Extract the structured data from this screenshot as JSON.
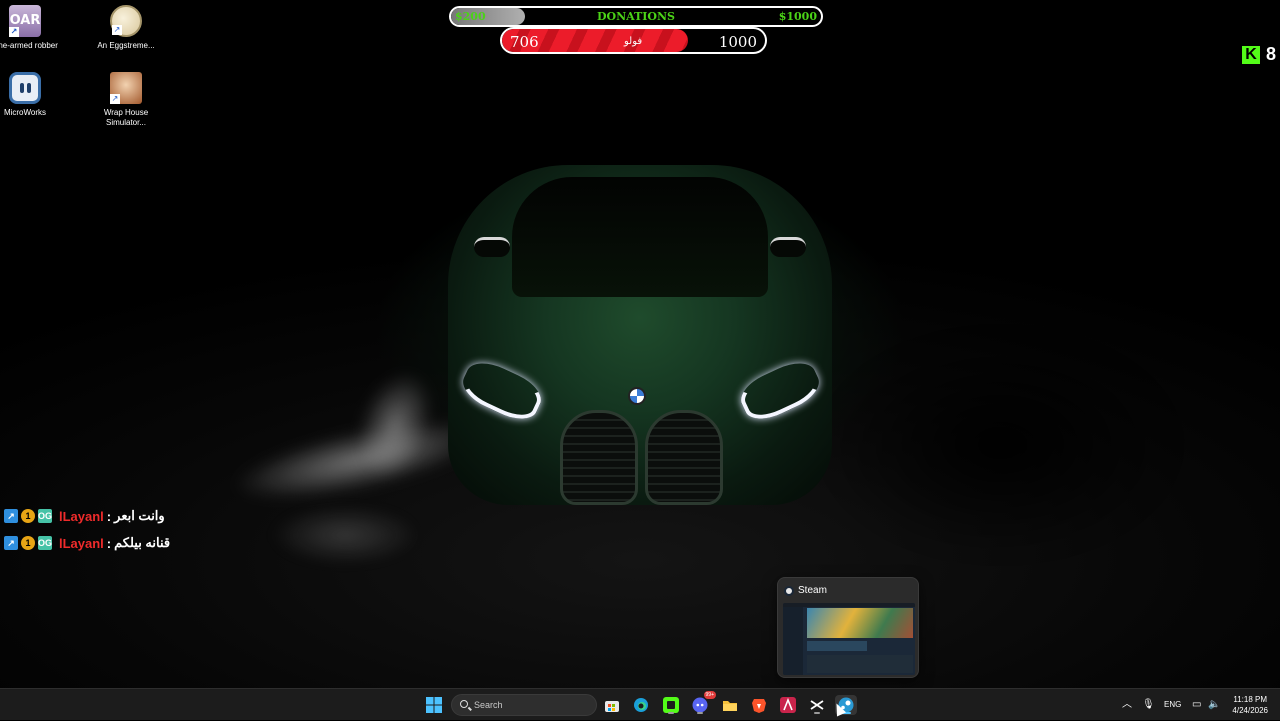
{
  "desktop_icons": [
    {
      "label": "One-armed robber",
      "icon": "one-armed-robber-icon"
    },
    {
      "label": "An Eggstreme...",
      "icon": "egg-game-icon"
    },
    {
      "label": "MicroWorks",
      "icon": "microworks-icon"
    },
    {
      "label": "Wrap House Simulator...",
      "icon": "wrap-house-icon"
    }
  ],
  "donations": {
    "min_label": "$200",
    "title": "DONATIONS",
    "max_label": "$1000",
    "progress_fraction": 0.2
  },
  "follow_goal": {
    "current": "706",
    "label": "فولو",
    "target": "1000",
    "progress_fraction": 0.706
  },
  "kick": {
    "icon": "kick-logo-icon",
    "count": "8",
    "color": "#53fc18"
  },
  "chat": [
    {
      "badges": [
        "verified",
        "1",
        "OG"
      ],
      "user": "lLayanl",
      "separator": ":",
      "message": "وانت ابعر"
    },
    {
      "badges": [
        "verified",
        "1",
        "OG"
      ],
      "user": "lLayanl",
      "separator": ":",
      "message": "قنانه بيلكم"
    }
  ],
  "taskbar_preview": {
    "title": "Steam",
    "icon": "steam-icon"
  },
  "taskbar": {
    "search_placeholder": "Search",
    "apps": [
      "start-icon",
      "store-icon",
      "edge-icon",
      "kick-app-icon",
      "discord-icon",
      "file-explorer-icon",
      "brave-icon",
      "affinity-icon",
      "capcut-icon",
      "steam-icon"
    ],
    "discord_badge": "99+",
    "language": "ENG",
    "time": "11:18 PM",
    "date": "4/24/2026"
  },
  "colors": {
    "donation_text": "#4bd317",
    "follow_fill": "#ec1c2a",
    "chat_user": "#ef2b2b",
    "taskbar_bg": "#1c1c1c"
  }
}
